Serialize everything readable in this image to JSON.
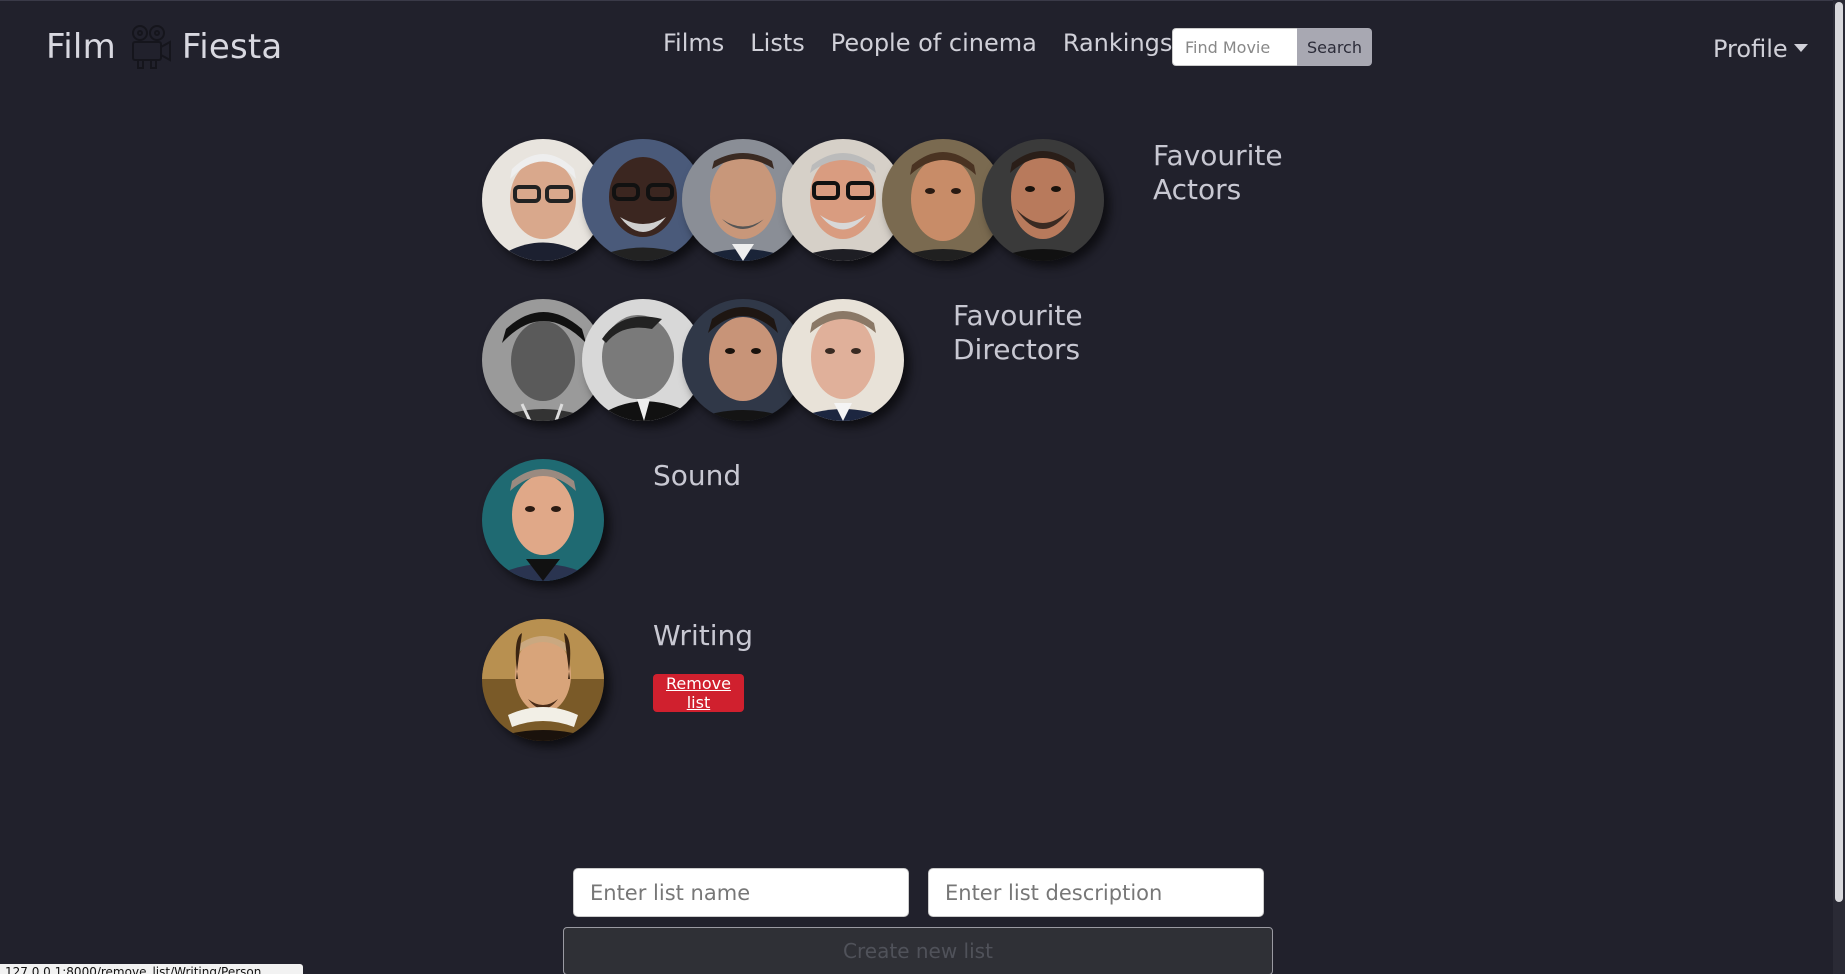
{
  "brand": {
    "left": "Film",
    "right": "Fiesta",
    "icon": "film-camera-icon"
  },
  "nav": {
    "films": "Films",
    "lists": "Lists",
    "people": "People of cinema",
    "rankings": "Rankings"
  },
  "search": {
    "placeholder": "Find Movie",
    "button": "Search"
  },
  "profile": {
    "label": "Profile"
  },
  "lists": [
    {
      "title": "Favourite Actors",
      "count": 6
    },
    {
      "title": "Favourite Directors",
      "count": 4
    },
    {
      "title": "Sound",
      "count": 1
    },
    {
      "title": "Writing",
      "count": 1,
      "action": "Remove list"
    }
  ],
  "form": {
    "name_placeholder": "Enter list name",
    "description_placeholder": "Enter list description",
    "create_button": "Create new list"
  },
  "status_url": "127.0.0.1:8000/remove_list/Writing/Person",
  "colors": {
    "background": "#21212c",
    "danger": "#d0202e",
    "search_button": "#a8a8b2"
  }
}
